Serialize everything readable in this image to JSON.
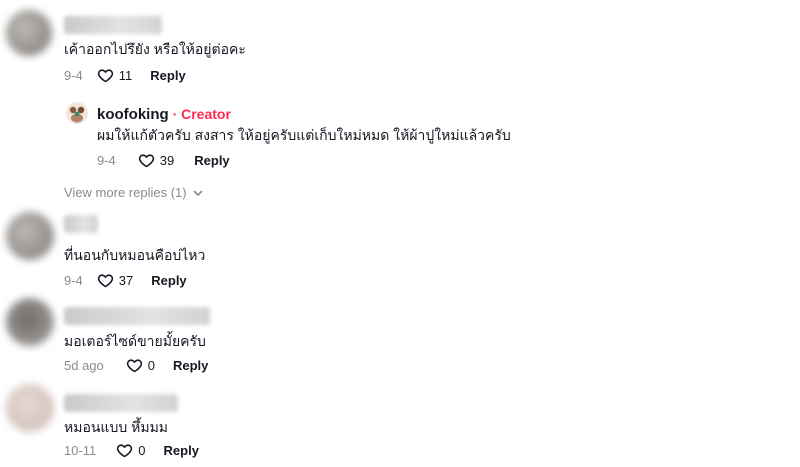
{
  "comments": [
    {
      "text": "เค้าออกไปรึยัง หรือให้อยู่ต่อคะ",
      "date": "9-4",
      "likes": "11",
      "reply_label": "Reply"
    },
    {
      "text": "ที่นอนกับหมอนคือบ่ไหว",
      "date": "9-4",
      "likes": "37",
      "reply_label": "Reply"
    },
    {
      "text": "มอเตอร์ไซด์ขายมั้ยครับ",
      "date": "5d ago",
      "likes": "0",
      "reply_label": "Reply"
    },
    {
      "text": "หมอนแบบ หึ้มมม",
      "date": "10-11",
      "likes": "0",
      "reply_label": "Reply"
    }
  ],
  "creator_reply": {
    "username": "koofoking",
    "tag": "· Creator",
    "text": "ผมให้แก้ตัวครับ สงสาร ให้อยู่ครับแต่เก็บใหม่หมด ให้ผ้าปูใหม่แล้วครับ",
    "date": "9-4",
    "likes": "39",
    "reply_label": "Reply"
  },
  "view_more_replies": "View more replies (1)",
  "colors": {
    "accent_creator": "#fe2c55",
    "muted_text": "#8a8b91",
    "body_text": "#161823"
  }
}
